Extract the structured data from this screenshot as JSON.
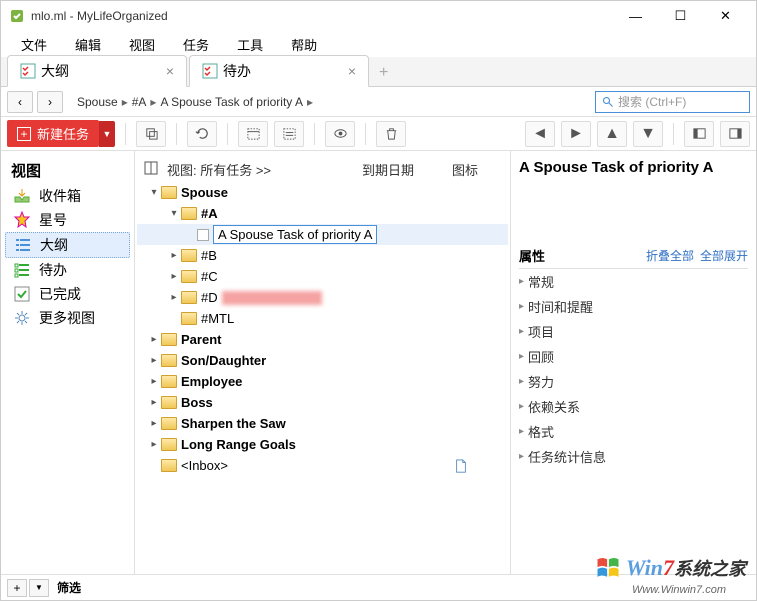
{
  "window": {
    "title": "mlo.ml - MyLifeOrganized"
  },
  "menu": {
    "file": "文件",
    "edit": "编辑",
    "view": "视图",
    "tasks": "任务",
    "tools": "工具",
    "help": "帮助"
  },
  "tabs": [
    {
      "label": "大纲"
    },
    {
      "label": "待办"
    }
  ],
  "breadcrumb": [
    "Spouse",
    "#A",
    "A Spouse Task of priority A"
  ],
  "search": {
    "placeholder": "搜索 (Ctrl+F)"
  },
  "toolbar": {
    "new_label": "新建任务"
  },
  "sidebar": {
    "title": "视图",
    "items": [
      {
        "label": "收件箱"
      },
      {
        "label": "星号"
      },
      {
        "label": "大纲"
      },
      {
        "label": "待办"
      },
      {
        "label": "已完成"
      },
      {
        "label": "更多视图"
      }
    ]
  },
  "list": {
    "header": {
      "title": "视图: 所有任务 >>",
      "due": "到期日期",
      "icon": "图标"
    },
    "tree": {
      "spouse": "Spouse",
      "a": "#A",
      "task_a": "A Spouse Task of priority A",
      "b": "#B",
      "c": "#C",
      "d": "#D",
      "mtl": "#MTL",
      "parent": "Parent",
      "son": "Son/Daughter",
      "employee": "Employee",
      "boss": "Boss",
      "sharpen": "Sharpen the Saw",
      "lrg": "Long Range Goals",
      "inbox": "<Inbox>"
    }
  },
  "details": {
    "title": "A Spouse Task of priority A",
    "props_title": "属性",
    "collapse": "折叠全部",
    "expand": "全部展开",
    "rows": [
      "常规",
      "时间和提醒",
      "项目",
      "回顾",
      "努力",
      "依赖关系",
      "格式",
      "任务统计信息"
    ]
  },
  "footer": {
    "filter": "筛选"
  },
  "watermark": {
    "brand1": "Win",
    "brand2": "7",
    "brand_suffix": "系统之家",
    "url": "Www.Winwin7.com"
  }
}
